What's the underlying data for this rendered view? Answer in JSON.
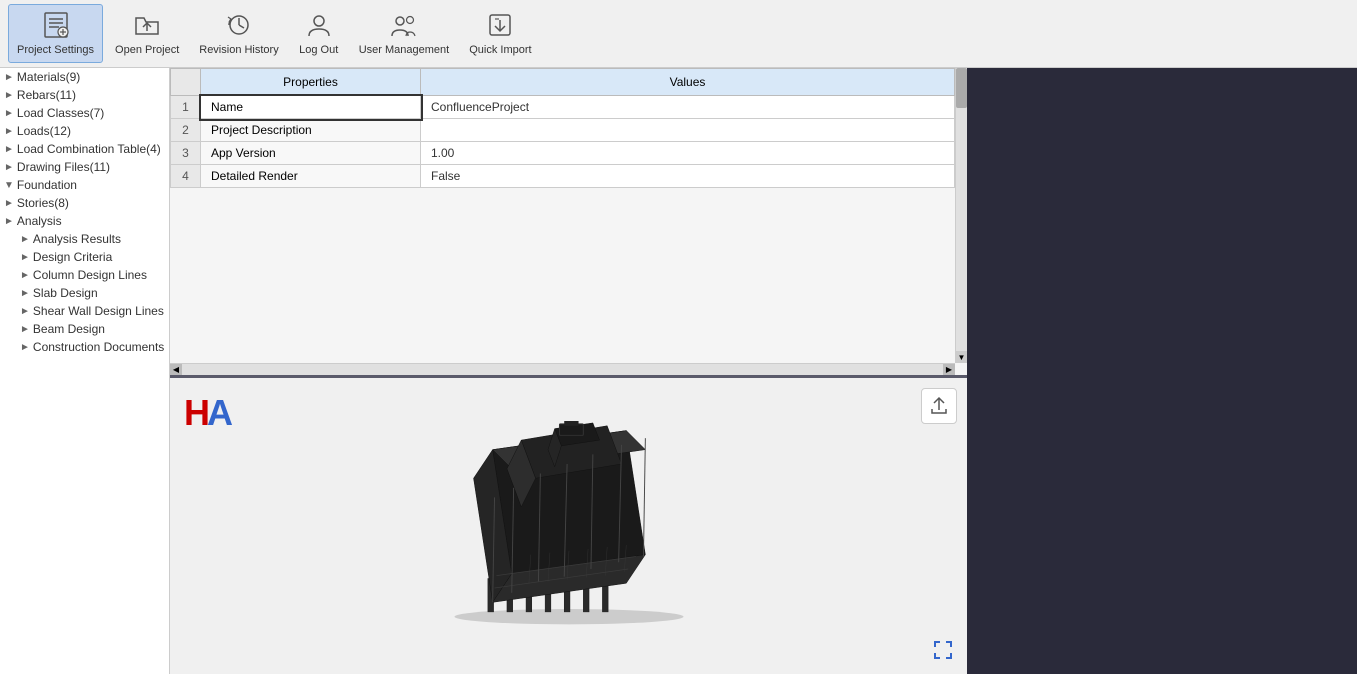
{
  "toolbar": {
    "buttons": [
      {
        "id": "project-settings",
        "label": "Project\nSettings",
        "icon": "📋",
        "active": true
      },
      {
        "id": "open-project",
        "label": "Open\nProject",
        "icon": "📁",
        "active": false
      },
      {
        "id": "revision-history",
        "label": "Revision\nHistory",
        "icon": "🕐",
        "active": false
      },
      {
        "id": "log-out",
        "label": "Log\nOut",
        "icon": "👤",
        "active": false
      },
      {
        "id": "user-management",
        "label": "User\nManagement",
        "icon": "👥",
        "active": false
      },
      {
        "id": "quick-import",
        "label": "Quick\nImport",
        "icon": "📤",
        "active": false
      }
    ]
  },
  "sidebar": {
    "items": [
      {
        "id": "materials",
        "label": "Materials(9)",
        "active": false,
        "expandable": true,
        "indent": 1
      },
      {
        "id": "rebars",
        "label": "Rebars(11)",
        "active": false,
        "expandable": true,
        "indent": 1
      },
      {
        "id": "load-classes",
        "label": "Load Classes(7)",
        "active": false,
        "expandable": true,
        "indent": 1
      },
      {
        "id": "loads",
        "label": "Loads(12)",
        "active": false,
        "expandable": true,
        "indent": 1
      },
      {
        "id": "load-combination-table",
        "label": "Load Combination Table(4)",
        "active": false,
        "expandable": true,
        "indent": 1
      },
      {
        "id": "drawing-files",
        "label": "Drawing Files(11)",
        "active": false,
        "expandable": true,
        "indent": 1
      },
      {
        "id": "foundation",
        "label": "Foundation",
        "active": false,
        "expandable": true,
        "indent": 0
      },
      {
        "id": "stories",
        "label": "Stories(8)",
        "active": false,
        "expandable": true,
        "indent": 1
      },
      {
        "id": "analysis",
        "label": "Analysis",
        "active": false,
        "expandable": true,
        "indent": 0
      },
      {
        "id": "analysis-results",
        "label": "Analysis Results",
        "active": false,
        "expandable": true,
        "indent": 1
      },
      {
        "id": "design-criteria",
        "label": "Design Criteria",
        "active": false,
        "expandable": true,
        "indent": 1
      },
      {
        "id": "column-design-lines",
        "label": "Column Design Lines",
        "active": false,
        "expandable": true,
        "indent": 1
      },
      {
        "id": "slab-design",
        "label": "Slab Design",
        "active": false,
        "expandable": true,
        "indent": 1
      },
      {
        "id": "shear-wall-design-lines",
        "label": "Shear Wall Design Lines",
        "active": false,
        "expandable": true,
        "indent": 1
      },
      {
        "id": "beam-design",
        "label": "Beam Design",
        "active": false,
        "expandable": true,
        "indent": 1
      },
      {
        "id": "construction-documents",
        "label": "Construction Documents",
        "active": false,
        "expandable": true,
        "indent": 1
      }
    ]
  },
  "properties_table": {
    "col_properties": "Properties",
    "col_values": "Values",
    "rows": [
      {
        "num": "1",
        "property": "Name",
        "value": "ConfluenceProject",
        "editing": true
      },
      {
        "num": "2",
        "property": "Project Description",
        "value": "",
        "editing": false
      },
      {
        "num": "3",
        "property": "App Version",
        "value": "1.00",
        "editing": false
      },
      {
        "num": "4",
        "property": "Detailed Render",
        "value": "False",
        "editing": false
      }
    ]
  },
  "viewport": {
    "upload_icon": "⬆",
    "expand_icon": "⛶",
    "logo_text": "HA"
  }
}
